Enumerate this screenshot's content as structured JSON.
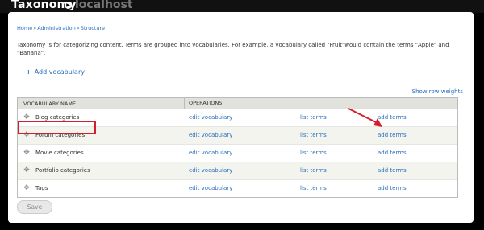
{
  "header": {
    "title": "Taxonomy",
    "host_text": "localhost"
  },
  "breadcrumb": [
    "Home",
    "Administration",
    "Structure"
  ],
  "description": "Taxonomy is for categorizing content. Terms are grouped into vocabularies. For example, a vocabulary called \"Fruit\"would contain the terms \"Apple\" and \"Banana\".",
  "actions": {
    "add_vocabulary": "Add vocabulary",
    "show_row_weights": "Show row weights"
  },
  "table": {
    "headers": [
      "VOCABULARY NAME",
      "OPERATIONS"
    ],
    "rows": [
      {
        "name": "Blog categories",
        "edit": "edit vocabulary",
        "list": "list terms",
        "add": "add terms"
      },
      {
        "name": "Forum categories",
        "edit": "edit vocabulary",
        "list": "list terms",
        "add": "add terms"
      },
      {
        "name": "Movie categories",
        "edit": "edit vocabulary",
        "list": "list terms",
        "add": "add terms"
      },
      {
        "name": "Portfolio categories",
        "edit": "edit vocabulary",
        "list": "list terms",
        "add": "add terms"
      },
      {
        "name": "Tags",
        "edit": "edit vocabulary",
        "list": "list terms",
        "add": "add terms"
      }
    ]
  },
  "form": {
    "save_label": "Save"
  },
  "colors": {
    "link": "#2a6ebb",
    "annotation": "#d21f2c",
    "header_bg": "#e1e2dc"
  }
}
